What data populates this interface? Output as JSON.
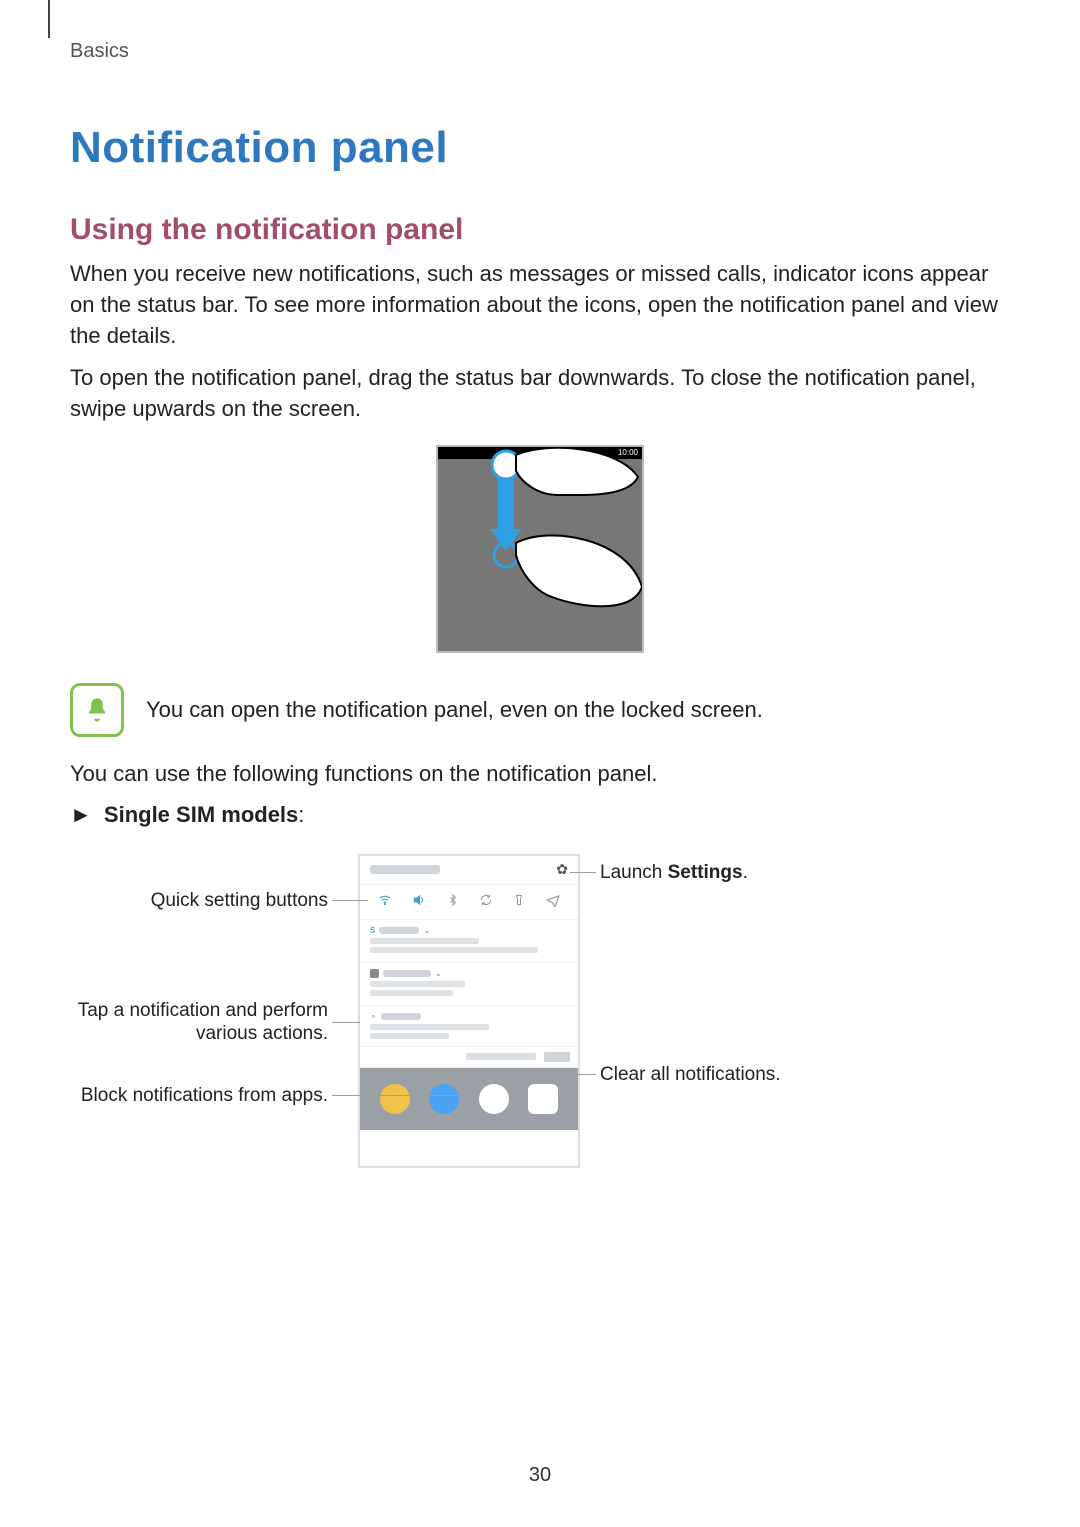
{
  "runningHead": "Basics",
  "title": "Notification panel",
  "subhead": "Using the notification panel",
  "para1": "When you receive new notifications, such as messages or missed calls, indicator icons appear on the status bar. To see more information about the icons, open the notification panel and view the details.",
  "para2": "To open the notification panel, drag the status bar downwards. To close the notification panel, swipe upwards on the screen.",
  "statusTime": "10:00",
  "noteText": "You can open the notification panel, even on the locked screen.",
  "para3": "You can use the following functions on the notification panel.",
  "bullet": {
    "arrow": "►",
    "label": "Single SIM models",
    "colon": ":"
  },
  "callouts": {
    "quickSettings": "Quick setting buttons",
    "tapNotification": "Tap a notification and perform various actions.",
    "blockNotifications": "Block notifications from apps.",
    "launchSettingsPrefix": "Launch ",
    "launchSettingsBold": "Settings",
    "launchSettingsSuffix": ".",
    "clearAll": "Clear all notifications."
  },
  "pageNumber": "30"
}
